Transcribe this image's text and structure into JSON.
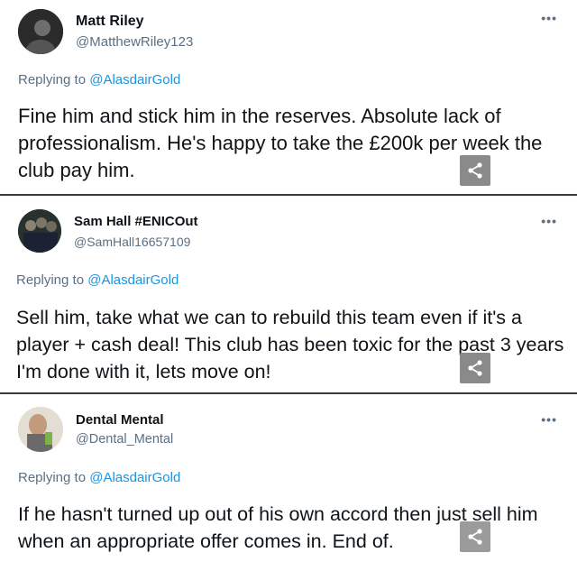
{
  "tweets": [
    {
      "name": "Matt Riley",
      "handle": "@MatthewRiley123",
      "reply_prefix": "Replying to",
      "reply_to": "@AlasdairGold",
      "text": "Fine him and stick him in the reserves. Absolute lack of professionalism. He's happy to take the £200k per week the club pay him."
    },
    {
      "name": "Sam Hall #ENICOut",
      "handle": "@SamHall16657109",
      "reply_prefix": "Replying to",
      "reply_to": "@AlasdairGold",
      "text": "Sell him, take what we can to rebuild this team even if it's a player + cash deal! This club has been toxic for the past 3 years I'm done with it, lets move on!"
    },
    {
      "name": "Dental Mental",
      "handle": "@Dental_Mental",
      "reply_prefix": "Replying to",
      "reply_to": "@AlasdairGold",
      "text": "If he hasn't turned up out of his own accord then just sell him when an appropriate offer comes in. End of."
    }
  ],
  "more_icon": "more-horizontal-icon",
  "share_icon": "share-icon",
  "colors": {
    "link": "#1b95e0",
    "secondary": "#5b7083",
    "separator": "#3a3a3a",
    "share_bg": "#8a8a8a"
  }
}
